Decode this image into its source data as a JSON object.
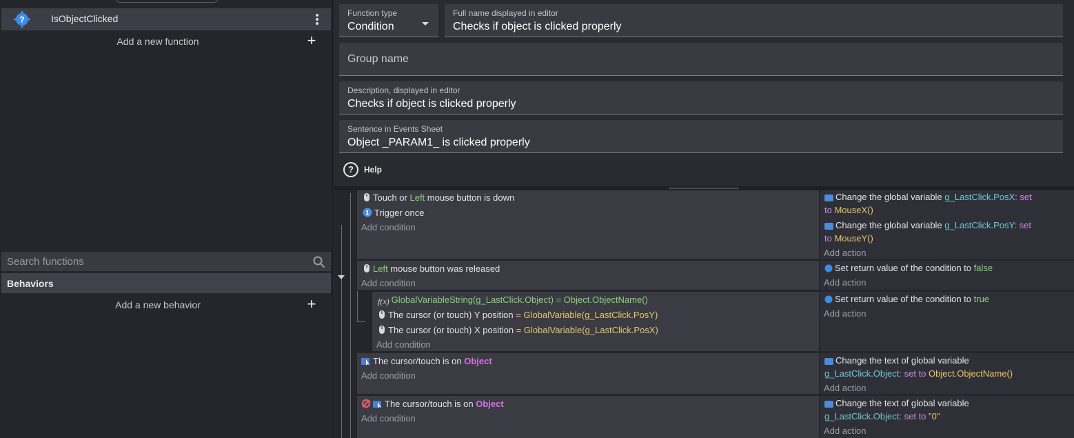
{
  "sidebar": {
    "function_name": "IsObjectClicked",
    "add_function": "Add a new function",
    "search_placeholder": "Search functions",
    "behaviors_header": "Behaviors",
    "add_behavior": "Add a new behavior"
  },
  "form": {
    "function_type_label": "Function type",
    "function_type_value": "Condition",
    "full_name_label": "Full name displayed in editor",
    "full_name_value": "Checks if object is clicked properly",
    "group_name_placeholder": "Group name",
    "description_label": "Description, displayed in editor",
    "description_value": "Checks if object is clicked properly",
    "sentence_label": "Sentence in Events Sheet",
    "sentence_value": "Object _PARAM1_ is clicked properly",
    "help_label": "Help"
  },
  "events": {
    "add_condition": "Add condition",
    "add_action": "Add action",
    "e1": {
      "c1": {
        "a": "Touch or ",
        "b": "Left",
        "c": " mouse button is down"
      },
      "c2": "Trigger once",
      "a1": {
        "a": "Change the global variable ",
        "var": "g_LastClick.PosX",
        "set": ": set",
        "to": "to ",
        "val": "MouseX()"
      },
      "a2": {
        "a": "Change the global variable ",
        "var": "g_LastClick.PosY",
        "set": ": set",
        "to": "to ",
        "val": "MouseY()"
      }
    },
    "e2": {
      "c1": {
        "a": "Left",
        "b": " mouse button was released"
      },
      "a1": {
        "a": "Set return value of the condition to ",
        "val": "false"
      }
    },
    "e3": {
      "c1": {
        "a": "GlobalVariableString(g_LastClick.Object)",
        "op": " = ",
        "b": "Object.ObjectName()"
      },
      "c2": {
        "a": "The cursor (or touch) Y position ",
        "op": "= ",
        "b": "GlobalVariable(g_LastClick.PosY)"
      },
      "c3": {
        "a": "The cursor (or touch) X position ",
        "op": "= ",
        "b": "GlobalVariable(g_LastClick.PosX)"
      },
      "a1": {
        "a": "Set return value of the condition to ",
        "val": "true"
      }
    },
    "e4": {
      "c1": {
        "a": "The cursor/touch is on ",
        "obj": "Object"
      },
      "a1": {
        "a": "Change the text of global variable ",
        "var": "g_LastClick.Object",
        "set": ": set to ",
        "val": "Object.ObjectName()"
      }
    },
    "e5": {
      "c1": {
        "a": "The cursor/touch is on ",
        "obj": "Object"
      },
      "a1": {
        "a": "Change the text of global variable ",
        "var": "g_LastClick.Object",
        "set": ": set to ",
        "val": "\"0\""
      }
    }
  },
  "colors": {
    "accent_green": "#8fd07a",
    "accent_yellow": "#e8c56a",
    "accent_cyan": "#6ec7d6",
    "accent_purple": "#c98ae8"
  }
}
